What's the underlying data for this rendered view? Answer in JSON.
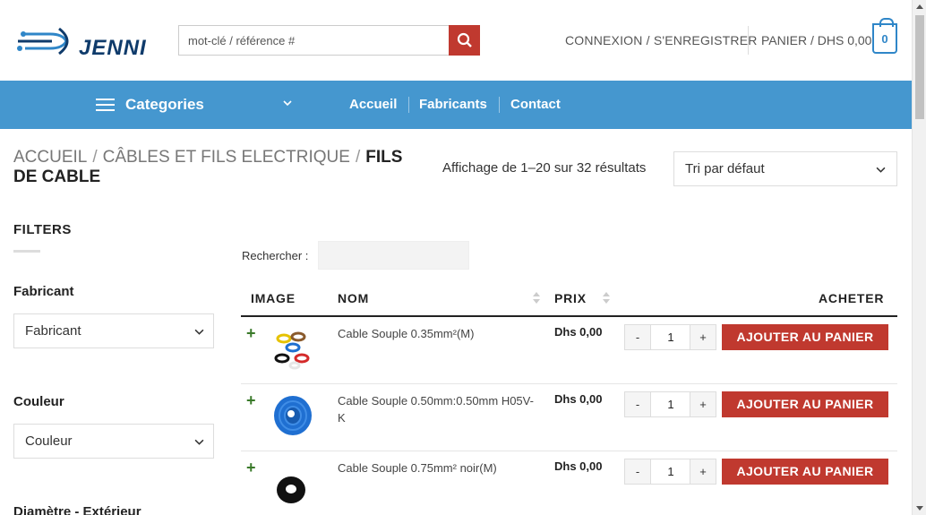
{
  "header": {
    "logo_text": "JENNI",
    "search_placeholder": "mot-clé / référence #",
    "account_label": "CONNEXION / S'ENREGISTRER",
    "cart_label": "PANIER / DHS 0,00",
    "cart_count": "0"
  },
  "nav": {
    "categories_label": "Categories",
    "links": [
      "Accueil",
      "Fabricants",
      "Contact"
    ]
  },
  "breadcrumb": {
    "items": [
      "ACCUEIL",
      "CÂBLES ET FILS ELECTRIQUE"
    ],
    "current": "FILS DE CABLE",
    "separator": "/"
  },
  "toolbar": {
    "result_count": "Affichage de 1–20 sur 32 résultats",
    "sort_value": "Tri par défaut"
  },
  "sidebar": {
    "title": "FILTERS",
    "filters": [
      {
        "label": "Fabricant",
        "value": "Fabricant"
      },
      {
        "label": "Couleur",
        "value": "Couleur"
      },
      {
        "label": "Diamètre - Extérieur",
        "value": ""
      }
    ]
  },
  "table": {
    "search_label": "Rechercher :",
    "headers": {
      "image": "IMAGE",
      "name": "NOM",
      "price": "PRIX",
      "buy": "ACHETER"
    },
    "rows": [
      {
        "name": "Cable Souple 0.35mm²(M)",
        "price": "Dhs 0,00",
        "qty": "1"
      },
      {
        "name": "Cable Souple 0.50mm:0.50mm H05V-K",
        "price": "Dhs 0,00",
        "qty": "1"
      },
      {
        "name": "Cable Souple 0.75mm² noir(M)",
        "price": "Dhs 0,00",
        "qty": "1"
      }
    ],
    "add_to_cart_label": "AJOUTER AU PANIER",
    "qty_minus": "-",
    "qty_plus": "+",
    "expand_symbol": "+"
  },
  "colors": {
    "nav_bg": "#4597cf",
    "accent_red": "#c0392f",
    "badge_blue": "#2f86c8"
  }
}
